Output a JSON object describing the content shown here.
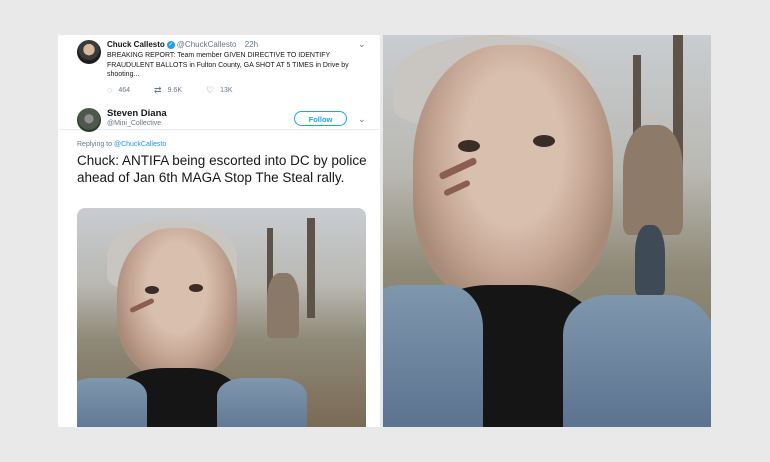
{
  "quoted_tweet": {
    "name": "Chuck Callesto",
    "handle": "@ChuckCallesto",
    "time": "22h",
    "text": "BREAKING REPORT: Team member  GIVEN DIRECTIVE TO IDENTIFY FRAUDULENT BALLOTS in Fulton County, GA SHOT AT 5 TIMES in Drive by shooting...",
    "replies": "464",
    "retweets": "9.6K",
    "likes": "13K"
  },
  "tweet": {
    "name": "Steven Diana",
    "handle": "@Mini_Collective",
    "follow_label": "Follow",
    "replying_prefix": "Replying to",
    "replying_to": "@ChuckCallesto",
    "text": "Chuck: ANTIFA being escorted into DC by police ahead of Jan 6th MAGA Stop The Steal rally."
  },
  "icons": {
    "reply": "reply-icon",
    "retweet": "retweet-icon",
    "like": "heart-icon",
    "verified": "verified-icon",
    "caret": "chevron-down-icon"
  },
  "colors": {
    "twitter_blue": "#1da1f2",
    "background": "#e9e9ea"
  }
}
